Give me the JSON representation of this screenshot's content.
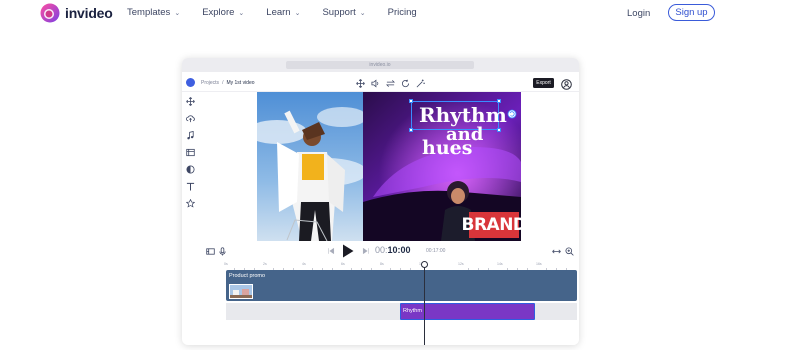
{
  "nav": {
    "brand": "invideo",
    "links": [
      "Templates",
      "Explore",
      "Learn",
      "Support",
      "Pricing"
    ],
    "chevrons": [
      true,
      true,
      true,
      true,
      false
    ],
    "login": "Login",
    "signup": "Sign up"
  },
  "browser": {
    "url": "invideo.io"
  },
  "editor": {
    "breadcrumb": {
      "projects": "Projects",
      "separator": "/",
      "current": "My 1st video"
    },
    "export": "Export",
    "toolbar_icons": [
      "move-icon",
      "volume-icon",
      "swap-icon",
      "refresh-icon",
      "magic-wand-icon"
    ],
    "left_tools": [
      "move-tool-icon",
      "upload-icon",
      "music-icon",
      "media-icon",
      "shapes-icon",
      "text-icon",
      "star-icon"
    ],
    "canvas": {
      "headline_1": "Rhythm",
      "headline_2": "and",
      "headline_3": "hues",
      "brand_tag": "BRAND"
    },
    "timeline": {
      "current_time": "00:",
      "current_time_bold": "10:00",
      "total_time": "00:17:00",
      "ruler_labels": [
        "0s",
        "2s",
        "4s",
        "6s",
        "8s",
        "10s",
        "12s",
        "14s",
        "16s"
      ],
      "track_1_label": "Product promo",
      "track_2_label": "Rhythm"
    }
  },
  "colors": {
    "accent": "#3a5bd9",
    "track_blue": "#45648a",
    "track_purple": "#7a37c5",
    "brand_red": "#d8353a"
  }
}
